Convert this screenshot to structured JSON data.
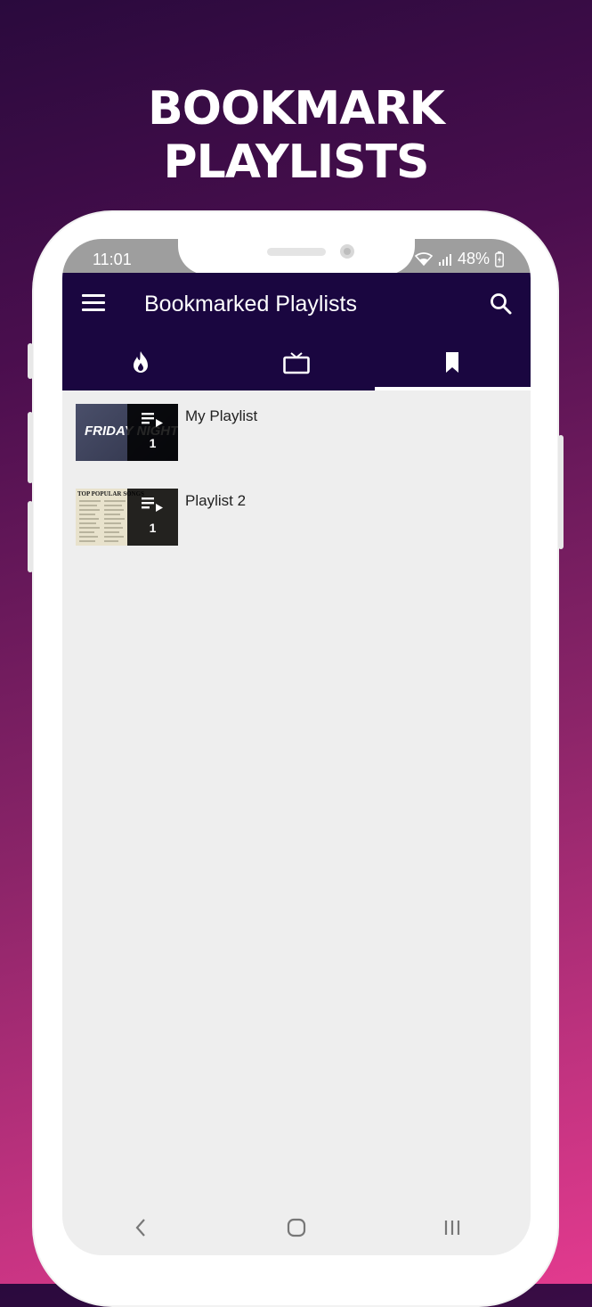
{
  "promo": {
    "line1": "BOOKMARK",
    "line2": "PLAYLISTS"
  },
  "status": {
    "time": "11:01",
    "battery": "48%"
  },
  "appbar": {
    "title": "Bookmarked Playlists"
  },
  "tabs": [
    {
      "icon": "flame-icon",
      "active": false
    },
    {
      "icon": "tv-icon",
      "active": false
    },
    {
      "icon": "bookmark-icon",
      "active": true
    }
  ],
  "playlists": [
    {
      "title": "My Playlist",
      "count": "1",
      "thumb_text": "FRIDAY NIGHTS"
    },
    {
      "title": "Playlist 2",
      "count": "1",
      "thumb_text": "TOP POPULAR SONGS"
    }
  ],
  "colors": {
    "appbar": "#1a0640",
    "screen_bg": "#eeeeee",
    "status_bar": "#9e9e9e"
  }
}
